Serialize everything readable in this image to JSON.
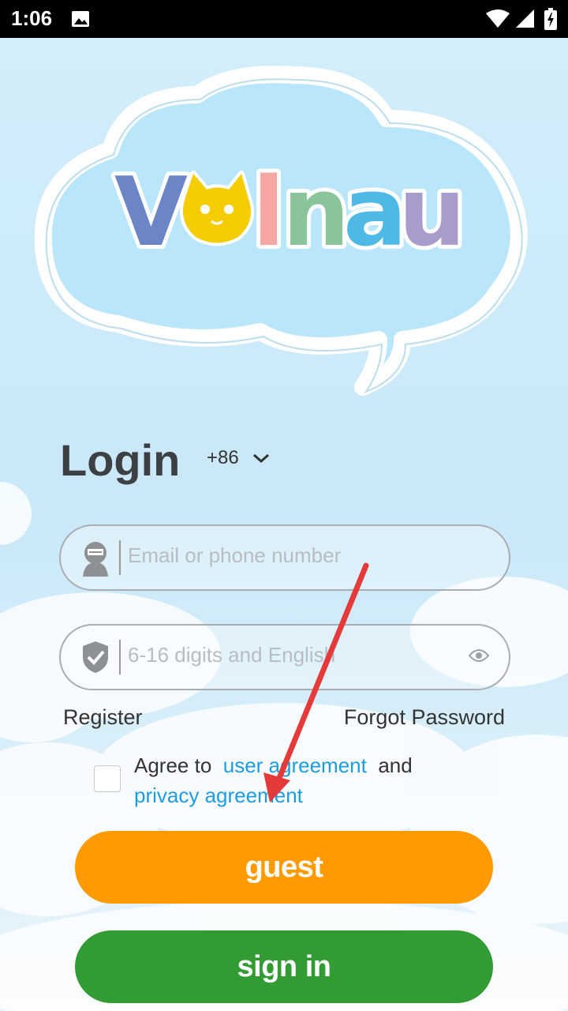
{
  "status_bar": {
    "time": "1:06",
    "icons": [
      "image-icon",
      "wifi-icon",
      "signal-icon",
      "battery-icon"
    ]
  },
  "logo": {
    "letters": [
      "V",
      "l",
      "n",
      "a",
      "u"
    ],
    "colors": [
      "#6c85c7",
      "#f6a7a5",
      "#8ac49a",
      "#4fb9e6",
      "#a79ccb"
    ],
    "cat_color": "#f5cc00"
  },
  "login": {
    "title": "Login",
    "country_code": "+86"
  },
  "fields": {
    "account_placeholder": "Email or phone number",
    "password_placeholder": "6-16 digits and English"
  },
  "links": {
    "register": "Register",
    "forgot_password": "Forgot Password"
  },
  "agreement": {
    "prefix": "Agree to",
    "user_agreement": "user agreement",
    "and": "and",
    "privacy_agreement": "privacy agreement",
    "checked": false
  },
  "buttons": {
    "guest": "guest",
    "sign_in": "sign in"
  },
  "colors": {
    "guest": "#ff9a00",
    "sign_in": "#339b34",
    "link": "#1f9be0",
    "annotation_arrow": "#e53a3a"
  }
}
